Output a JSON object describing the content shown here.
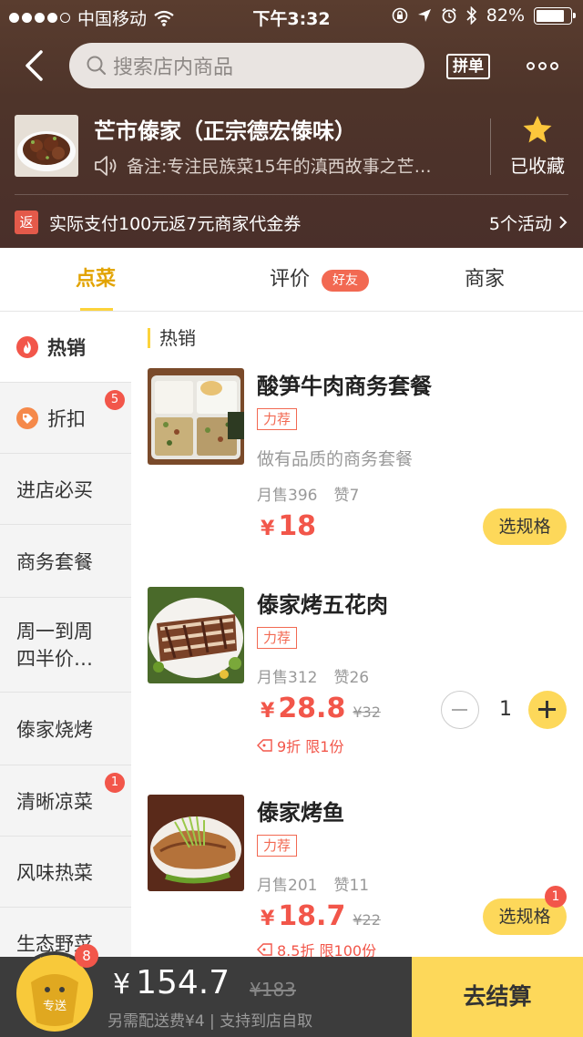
{
  "status_bar": {
    "carrier": "中国移动",
    "time": "下午3:32",
    "battery": "82%"
  },
  "header": {
    "search_placeholder": "搜索店内商品",
    "pindan_label": "拼单",
    "store_name": "芒市傣家（正宗德宏傣味）",
    "store_note": "备注:专注民族菜15年的滇西故事之芒…",
    "favorite_label": "已收藏",
    "promo_badge": "返",
    "promo_text": "实际支付100元返7元商家代金券",
    "activities_label": "5个活动"
  },
  "tabs": {
    "order": "点菜",
    "review": "评价",
    "friend_badge": "好友",
    "merchant": "商家"
  },
  "sidebar": {
    "items": [
      {
        "label": "热销"
      },
      {
        "label": "折扣",
        "count": "5"
      },
      {
        "label": "进店必买"
      },
      {
        "label": "商务套餐"
      },
      {
        "label": "周一到周四半价…"
      },
      {
        "label": "傣家烧烤"
      },
      {
        "label": "清晰凉菜",
        "count": "1"
      },
      {
        "label": "风味热菜"
      },
      {
        "label": "生态野菜"
      }
    ]
  },
  "content": {
    "section_title": "热销",
    "dishes": [
      {
        "name": "酸笋牛肉商务套餐",
        "tag": "力荐",
        "desc": "做有品质的商务套餐",
        "monthly_sales": "月售396",
        "likes": "赞7",
        "currency": "¥",
        "price": "18",
        "action_label": "选规格"
      },
      {
        "name": "傣家烤五花肉",
        "tag": "力荐",
        "monthly_sales": "月售312",
        "likes": "赞26",
        "currency": "¥",
        "price": "28.8",
        "orig_price": "¥32",
        "discount": "9折 限1份",
        "quantity": "1"
      },
      {
        "name": "傣家烤鱼",
        "tag": "力荐",
        "monthly_sales": "月售201",
        "likes": "赞11",
        "currency": "¥",
        "price": "18.7",
        "orig_price": "¥22",
        "discount": "8.5折 限100份",
        "action_label": "选规格",
        "action_count": "1"
      }
    ]
  },
  "cart": {
    "icon_label": "专送",
    "count": "8",
    "currency": "¥",
    "total": "154.7",
    "orig_total": "¥183",
    "note": "另需配送费¥4 | 支持到店自取",
    "checkout_label": "去结算"
  },
  "colors": {
    "accent_yellow": "#fdd85a",
    "price_red": "#f2564a",
    "header_brown": "#4e342a"
  }
}
